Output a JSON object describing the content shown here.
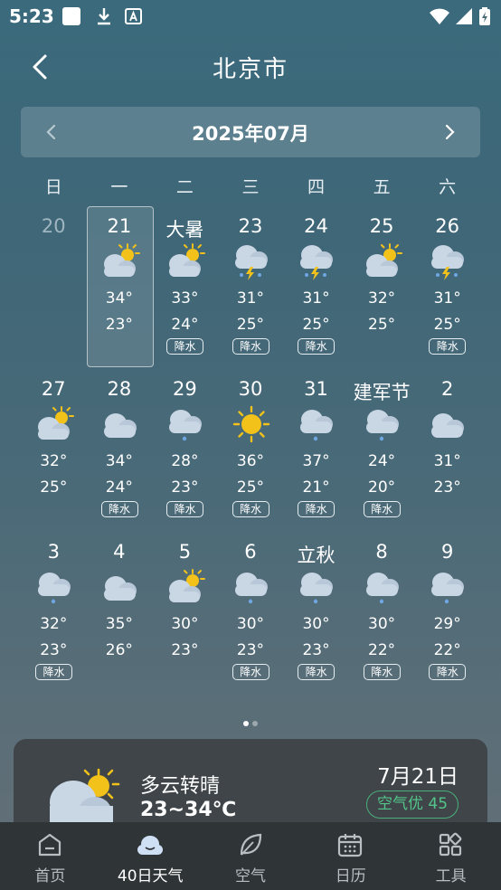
{
  "status_bar": {
    "time": "5:23"
  },
  "header": {
    "title": "北京市"
  },
  "calendar": {
    "month_label": "2025年07月",
    "weekdays": [
      "日",
      "一",
      "二",
      "三",
      "四",
      "五",
      "六"
    ],
    "rain_label": "降水",
    "weeks": [
      [
        {
          "day": "20",
          "faded": true
        },
        {
          "day": "21",
          "icon": "partly-cloudy",
          "hi": "34°",
          "lo": "23°",
          "selected": true
        },
        {
          "day": "大暑",
          "icon": "partly-cloudy",
          "hi": "33°",
          "lo": "24°",
          "rain": true
        },
        {
          "day": "23",
          "icon": "thunder-shower",
          "hi": "31°",
          "lo": "25°",
          "rain": true
        },
        {
          "day": "24",
          "icon": "thunder-shower",
          "hi": "31°",
          "lo": "25°",
          "rain": true
        },
        {
          "day": "25",
          "icon": "partly-cloudy",
          "hi": "32°",
          "lo": "25°"
        },
        {
          "day": "26",
          "icon": "thunder-shower",
          "hi": "31°",
          "lo": "25°",
          "rain": true
        }
      ],
      [
        {
          "day": "27",
          "icon": "partly-cloudy",
          "hi": "32°",
          "lo": "25°"
        },
        {
          "day": "28",
          "icon": "cloudy",
          "hi": "34°",
          "lo": "24°",
          "rain": true
        },
        {
          "day": "29",
          "icon": "light-rain",
          "hi": "28°",
          "lo": "23°",
          "rain": true
        },
        {
          "day": "30",
          "icon": "sunny",
          "hi": "36°",
          "lo": "25°",
          "rain": true
        },
        {
          "day": "31",
          "icon": "light-rain",
          "hi": "37°",
          "lo": "21°",
          "rain": true
        },
        {
          "day": "建军节",
          "icon": "light-rain",
          "hi": "24°",
          "lo": "20°",
          "rain": true
        },
        {
          "day": "2",
          "icon": "cloudy",
          "hi": "31°",
          "lo": "23°"
        }
      ],
      [
        {
          "day": "3",
          "icon": "light-rain",
          "hi": "32°",
          "lo": "23°",
          "rain": true
        },
        {
          "day": "4",
          "icon": "cloudy",
          "hi": "35°",
          "lo": "26°"
        },
        {
          "day": "5",
          "icon": "partly-cloudy",
          "hi": "30°",
          "lo": "23°"
        },
        {
          "day": "6",
          "icon": "light-rain",
          "hi": "30°",
          "lo": "23°",
          "rain": true
        },
        {
          "day": "立秋",
          "icon": "light-rain",
          "hi": "30°",
          "lo": "23°",
          "rain": true
        },
        {
          "day": "8",
          "icon": "light-rain",
          "hi": "30°",
          "lo": "22°",
          "rain": true
        },
        {
          "day": "9",
          "icon": "light-rain",
          "hi": "29°",
          "lo": "22°",
          "rain": true
        }
      ]
    ]
  },
  "pager": {
    "pages": 2,
    "current": 1
  },
  "summary": {
    "icon": "partly-cloudy",
    "description": "多云转晴",
    "temp_range": "23~34℃",
    "date": "7月21日",
    "aqi": "空气优 45"
  },
  "bottom_nav": [
    {
      "label": "首页",
      "icon": "home-icon"
    },
    {
      "label": "40日天气",
      "icon": "cloud-icon",
      "active": true
    },
    {
      "label": "空气",
      "icon": "leaf-icon"
    },
    {
      "label": "日历",
      "icon": "calendar-icon"
    },
    {
      "label": "工具",
      "icon": "grid-icon"
    }
  ],
  "colors": {
    "aqi_good": "#53c48a",
    "sun": "#f2c21a"
  }
}
